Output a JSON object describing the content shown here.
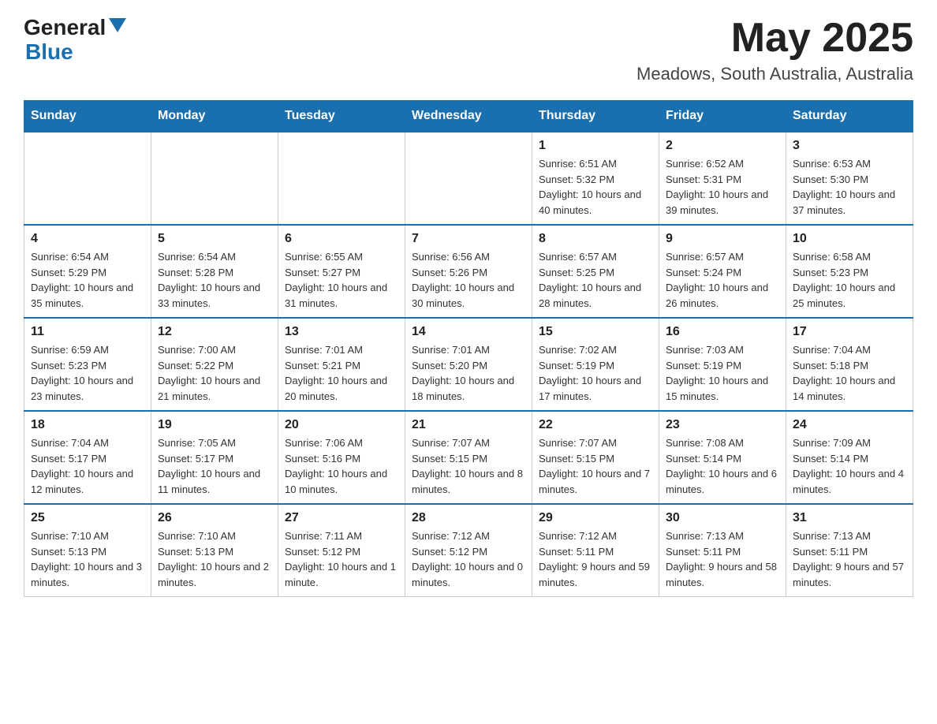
{
  "header": {
    "logo_general": "General",
    "logo_blue": "Blue",
    "month": "May 2025",
    "location": "Meadows, South Australia, Australia"
  },
  "days_of_week": [
    "Sunday",
    "Monday",
    "Tuesday",
    "Wednesday",
    "Thursday",
    "Friday",
    "Saturday"
  ],
  "weeks": [
    [
      {
        "day": "",
        "info": ""
      },
      {
        "day": "",
        "info": ""
      },
      {
        "day": "",
        "info": ""
      },
      {
        "day": "",
        "info": ""
      },
      {
        "day": "1",
        "info": "Sunrise: 6:51 AM\nSunset: 5:32 PM\nDaylight: 10 hours and 40 minutes."
      },
      {
        "day": "2",
        "info": "Sunrise: 6:52 AM\nSunset: 5:31 PM\nDaylight: 10 hours and 39 minutes."
      },
      {
        "day": "3",
        "info": "Sunrise: 6:53 AM\nSunset: 5:30 PM\nDaylight: 10 hours and 37 minutes."
      }
    ],
    [
      {
        "day": "4",
        "info": "Sunrise: 6:54 AM\nSunset: 5:29 PM\nDaylight: 10 hours and 35 minutes."
      },
      {
        "day": "5",
        "info": "Sunrise: 6:54 AM\nSunset: 5:28 PM\nDaylight: 10 hours and 33 minutes."
      },
      {
        "day": "6",
        "info": "Sunrise: 6:55 AM\nSunset: 5:27 PM\nDaylight: 10 hours and 31 minutes."
      },
      {
        "day": "7",
        "info": "Sunrise: 6:56 AM\nSunset: 5:26 PM\nDaylight: 10 hours and 30 minutes."
      },
      {
        "day": "8",
        "info": "Sunrise: 6:57 AM\nSunset: 5:25 PM\nDaylight: 10 hours and 28 minutes."
      },
      {
        "day": "9",
        "info": "Sunrise: 6:57 AM\nSunset: 5:24 PM\nDaylight: 10 hours and 26 minutes."
      },
      {
        "day": "10",
        "info": "Sunrise: 6:58 AM\nSunset: 5:23 PM\nDaylight: 10 hours and 25 minutes."
      }
    ],
    [
      {
        "day": "11",
        "info": "Sunrise: 6:59 AM\nSunset: 5:23 PM\nDaylight: 10 hours and 23 minutes."
      },
      {
        "day": "12",
        "info": "Sunrise: 7:00 AM\nSunset: 5:22 PM\nDaylight: 10 hours and 21 minutes."
      },
      {
        "day": "13",
        "info": "Sunrise: 7:01 AM\nSunset: 5:21 PM\nDaylight: 10 hours and 20 minutes."
      },
      {
        "day": "14",
        "info": "Sunrise: 7:01 AM\nSunset: 5:20 PM\nDaylight: 10 hours and 18 minutes."
      },
      {
        "day": "15",
        "info": "Sunrise: 7:02 AM\nSunset: 5:19 PM\nDaylight: 10 hours and 17 minutes."
      },
      {
        "day": "16",
        "info": "Sunrise: 7:03 AM\nSunset: 5:19 PM\nDaylight: 10 hours and 15 minutes."
      },
      {
        "day": "17",
        "info": "Sunrise: 7:04 AM\nSunset: 5:18 PM\nDaylight: 10 hours and 14 minutes."
      }
    ],
    [
      {
        "day": "18",
        "info": "Sunrise: 7:04 AM\nSunset: 5:17 PM\nDaylight: 10 hours and 12 minutes."
      },
      {
        "day": "19",
        "info": "Sunrise: 7:05 AM\nSunset: 5:17 PM\nDaylight: 10 hours and 11 minutes."
      },
      {
        "day": "20",
        "info": "Sunrise: 7:06 AM\nSunset: 5:16 PM\nDaylight: 10 hours and 10 minutes."
      },
      {
        "day": "21",
        "info": "Sunrise: 7:07 AM\nSunset: 5:15 PM\nDaylight: 10 hours and 8 minutes."
      },
      {
        "day": "22",
        "info": "Sunrise: 7:07 AM\nSunset: 5:15 PM\nDaylight: 10 hours and 7 minutes."
      },
      {
        "day": "23",
        "info": "Sunrise: 7:08 AM\nSunset: 5:14 PM\nDaylight: 10 hours and 6 minutes."
      },
      {
        "day": "24",
        "info": "Sunrise: 7:09 AM\nSunset: 5:14 PM\nDaylight: 10 hours and 4 minutes."
      }
    ],
    [
      {
        "day": "25",
        "info": "Sunrise: 7:10 AM\nSunset: 5:13 PM\nDaylight: 10 hours and 3 minutes."
      },
      {
        "day": "26",
        "info": "Sunrise: 7:10 AM\nSunset: 5:13 PM\nDaylight: 10 hours and 2 minutes."
      },
      {
        "day": "27",
        "info": "Sunrise: 7:11 AM\nSunset: 5:12 PM\nDaylight: 10 hours and 1 minute."
      },
      {
        "day": "28",
        "info": "Sunrise: 7:12 AM\nSunset: 5:12 PM\nDaylight: 10 hours and 0 minutes."
      },
      {
        "day": "29",
        "info": "Sunrise: 7:12 AM\nSunset: 5:11 PM\nDaylight: 9 hours and 59 minutes."
      },
      {
        "day": "30",
        "info": "Sunrise: 7:13 AM\nSunset: 5:11 PM\nDaylight: 9 hours and 58 minutes."
      },
      {
        "day": "31",
        "info": "Sunrise: 7:13 AM\nSunset: 5:11 PM\nDaylight: 9 hours and 57 minutes."
      }
    ]
  ]
}
